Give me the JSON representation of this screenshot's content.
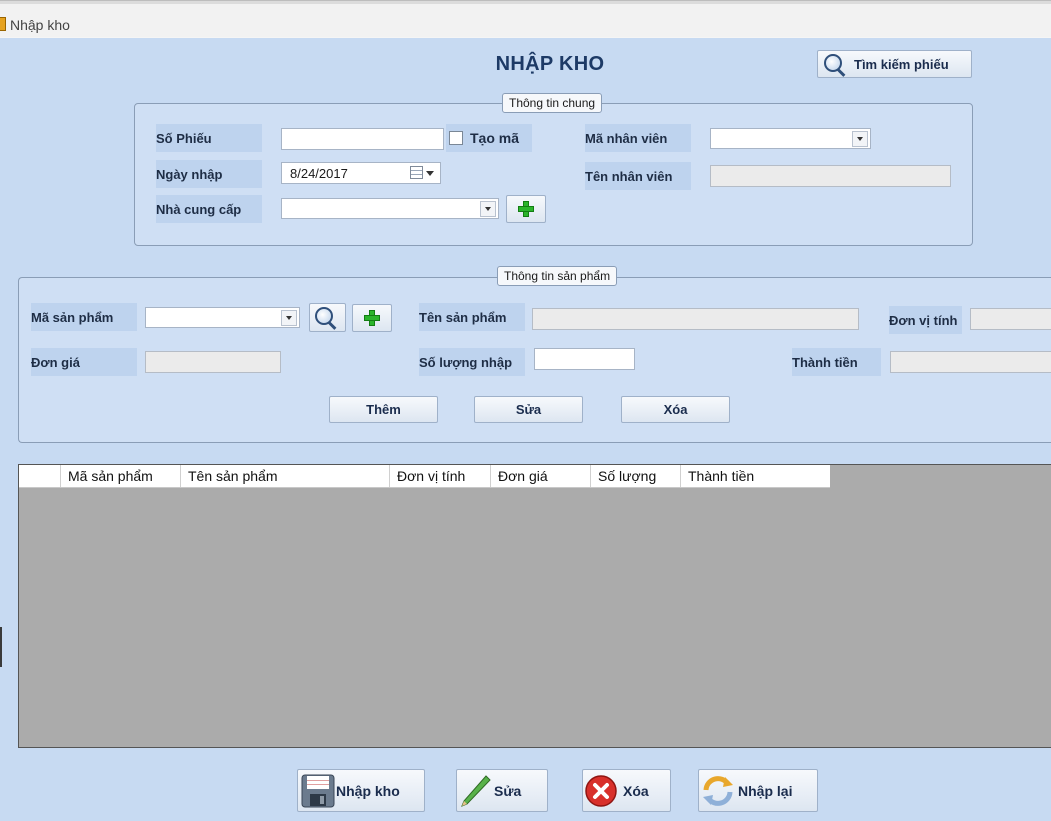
{
  "window": {
    "title": "Nhập kho"
  },
  "page_title": "NHẬP KHO",
  "search_button": {
    "label": "Tìm kiếm phiếu"
  },
  "general_info": {
    "legend": "Thông tin chung",
    "so_phieu": {
      "label": "Số Phiếu",
      "value": ""
    },
    "tao_ma": {
      "label": "Tạo mã",
      "checked": false
    },
    "ngay_nhap": {
      "label": "Ngày nhập",
      "value": "8/24/2017"
    },
    "nha_cung_cap": {
      "label": "Nhà cung cấp",
      "value": ""
    },
    "ma_nhan_vien": {
      "label": "Mã nhân viên",
      "value": ""
    },
    "ten_nhan_vien": {
      "label": "Tên nhân viên",
      "value": ""
    }
  },
  "product_info": {
    "legend": "Thông tin sản phẩm",
    "ma_san_pham": {
      "label": "Mã sản phẩm",
      "value": ""
    },
    "ten_san_pham": {
      "label": "Tên sản phẩm",
      "value": ""
    },
    "don_vi_tinh": {
      "label": "Đơn vị tính",
      "value": ""
    },
    "don_gia": {
      "label": "Đơn giá",
      "value": ""
    },
    "so_luong_nhap": {
      "label": "Số lượng nhập",
      "value": ""
    },
    "thanh_tien": {
      "label": "Thành tiền",
      "value": ""
    },
    "buttons": {
      "them": "Thêm",
      "sua": "Sửa",
      "xoa": "Xóa"
    }
  },
  "grid": {
    "columns": [
      "Mã sản phẩm",
      "Tên sản phẩm",
      "Đơn vị tính",
      "Đơn giá",
      "Số lượng",
      "Thành tiền"
    ],
    "rows": []
  },
  "bottom_buttons": {
    "nhap_kho": "Nhập kho",
    "sua": "Sửa",
    "xoa": "Xóa",
    "nhap_lai": "Nhập lại"
  },
  "icons": {
    "window": "app-icon",
    "search": "magnifier-icon",
    "add": "plus-icon",
    "calendar": "calendar-icon",
    "save": "floppy-disk-icon",
    "edit": "pencil-icon",
    "delete": "red-x-icon",
    "reset": "refresh-icon"
  }
}
